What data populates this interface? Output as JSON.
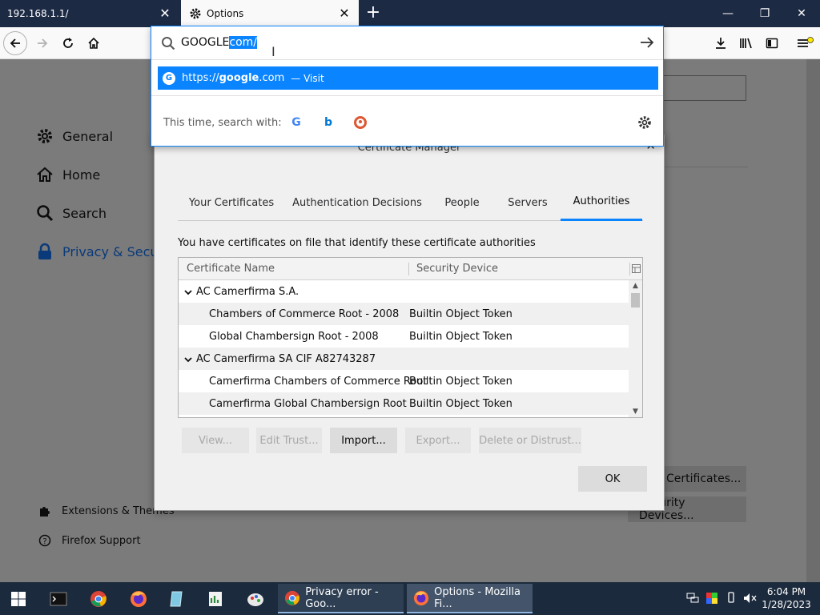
{
  "browser": {
    "tabs": [
      {
        "label": "192.168.1.1/"
      },
      {
        "label": "Options"
      }
    ],
    "urlbar": {
      "typed": "GOOGLE",
      "autofill_selected": "com/",
      "suggestion": {
        "prefix": "https://",
        "host": "google",
        "suffix": ".com",
        "separator": "—",
        "action": "Visit"
      },
      "oneoff_label": "This time, search with:"
    }
  },
  "options_page": {
    "categories": [
      {
        "label": "General"
      },
      {
        "label": "Home"
      },
      {
        "label": "Search"
      },
      {
        "label": "Privacy & Securi"
      }
    ],
    "footer_links": [
      {
        "label": "Extensions & Themes"
      },
      {
        "label": "Firefox Support"
      }
    ],
    "buttons": {
      "certificates": "Certificates...",
      "security_devices": "Security Devices..."
    }
  },
  "cert_manager": {
    "title": "Certificate Manager",
    "tabs": [
      {
        "label": "Your Certificates"
      },
      {
        "label": "Authentication Decisions"
      },
      {
        "label": "People"
      },
      {
        "label": "Servers"
      },
      {
        "label": "Authorities"
      }
    ],
    "intro": "You have certificates on file that identify these certificate authorities",
    "columns": [
      "Certificate Name",
      "Security Device"
    ],
    "rows": [
      {
        "name": "AC Camerfirma S.A.",
        "device": ""
      },
      {
        "name": "Chambers of Commerce Root - 2008",
        "device": "Builtin Object Token"
      },
      {
        "name": "Global Chambersign Root - 2008",
        "device": "Builtin Object Token"
      },
      {
        "name": "AC Camerfirma SA CIF A82743287",
        "device": ""
      },
      {
        "name": "Camerfirma Chambers of Commerce Root",
        "device": "Builtin Object Token"
      },
      {
        "name": "Camerfirma Global Chambersign Root",
        "device": "Builtin Object Token"
      }
    ],
    "buttons": {
      "view": "View...",
      "edit_trust": "Edit Trust...",
      "import": "Import...",
      "export": "Export...",
      "delete": "Delete or Distrust...",
      "ok": "OK"
    }
  },
  "taskbar": {
    "tasks": [
      {
        "label": "Privacy error - Goo..."
      },
      {
        "label": "Options - Mozilla Fi..."
      }
    ],
    "clock": {
      "time": "6:04 PM",
      "date": "1/28/2023"
    }
  },
  "colors": {
    "accent": "#0a84ff",
    "tabbar": "#1c2a44",
    "taskbar": "#1b2a3c"
  }
}
